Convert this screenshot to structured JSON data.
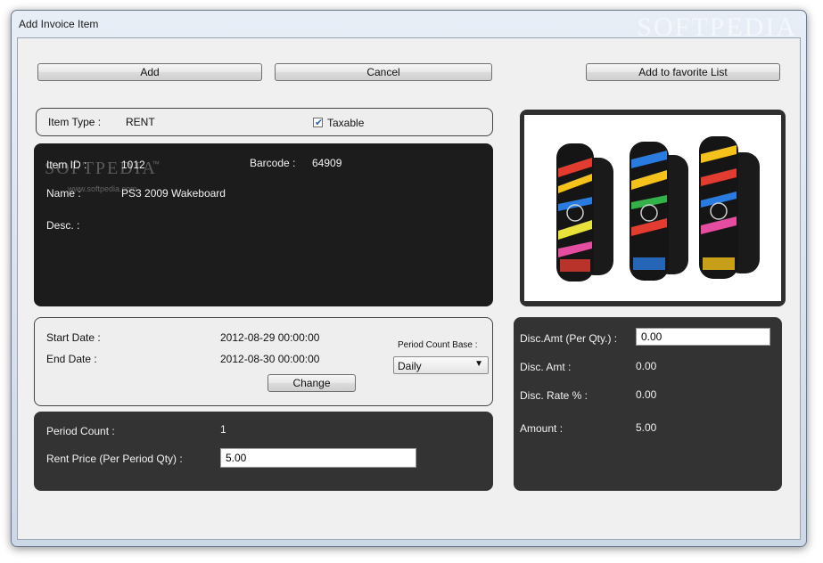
{
  "window": {
    "title": "Add Invoice Item",
    "watermark": "SOFTPEDIA"
  },
  "toolbar": {
    "add_label": "Add",
    "cancel_label": "Cancel",
    "favorite_label": "Add to favorite List"
  },
  "item_type": {
    "label": "Item Type :",
    "value": "RENT",
    "taxable_label": "Taxable",
    "taxable_checked": true
  },
  "item_info": {
    "id_label": "Item ID :",
    "id_value": "1012",
    "barcode_label": "Barcode :",
    "barcode_value": "64909",
    "name_label": "Name :",
    "name_value": "PS3 2009 Wakeboard",
    "desc_label": "Desc. :",
    "watermark": "SOFTPEDIA",
    "watermark_tm": "™",
    "watermark_url": "www.softpedia.com"
  },
  "dates": {
    "start_label": "Start Date :",
    "start_value": "2012-08-29 00:00:00",
    "end_label": "End Date :",
    "end_value": "2012-08-30 00:00:00",
    "change_label": "Change",
    "period_base_label": "Period Count Base :",
    "period_base_value": "Daily"
  },
  "rent": {
    "period_count_label": "Period Count :",
    "period_count_value": "1",
    "price_label": "Rent Price (Per Period Qty) :",
    "price_value": "5.00"
  },
  "discount": {
    "amt_per_qty_label": "Disc.Amt (Per Qty.) :",
    "amt_per_qty_value": "0.00",
    "amt_label": "Disc. Amt :",
    "amt_value": "0.00",
    "rate_label": "Disc. Rate % :",
    "rate_value": "0.00",
    "amount_label": "Amount :",
    "amount_value": "5.00"
  },
  "colors": {
    "dark_panel": "#333333",
    "black_panel": "#1c1c1c",
    "light_panel": "#eeeeee"
  },
  "icons": {
    "checkbox": "check-icon",
    "dropdown": "chevron-down-icon"
  }
}
